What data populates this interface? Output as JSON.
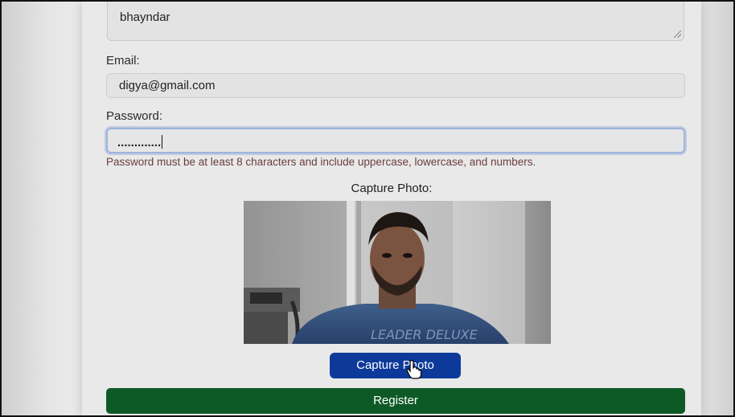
{
  "address": {
    "value": "bhayndar"
  },
  "email": {
    "label": "Email:",
    "value": "digya@gmail.com"
  },
  "password": {
    "label": "Password:",
    "value": ".............",
    "hint": "Password must be at least 8 characters and include uppercase, lowercase, and numbers."
  },
  "capture": {
    "title": "Capture Photo:",
    "button_label": "Capture Photo",
    "preview_text": "LEADER DELUXE"
  },
  "register": {
    "button_label": "Register"
  },
  "colors": {
    "capture_button": "#0d3a9a",
    "register_button": "#0e5a26",
    "focus_ring": "#9db4de"
  },
  "icons": {
    "cursor": "hand-pointer-icon",
    "resize": "resize-grip-icon"
  }
}
